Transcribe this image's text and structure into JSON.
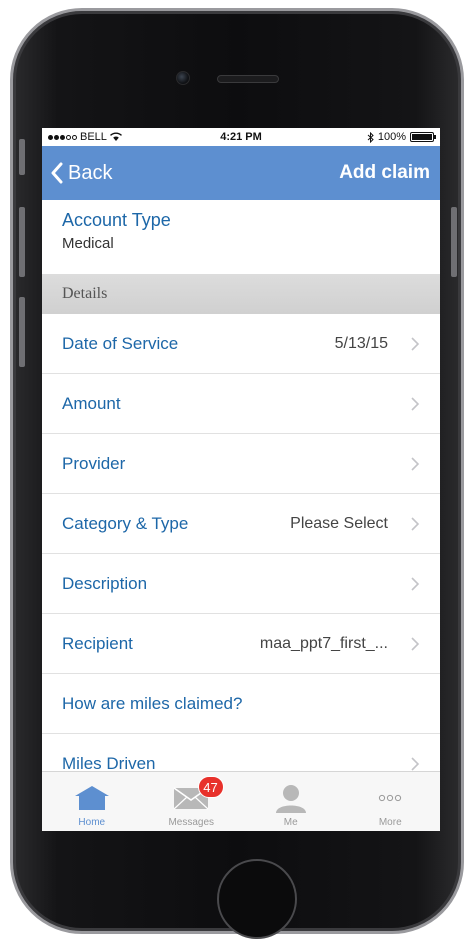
{
  "status_bar": {
    "carrier": "BELL",
    "time": "4:21 PM",
    "battery": "100%"
  },
  "nav": {
    "back_label": "Back",
    "title": "Add claim"
  },
  "account": {
    "label": "Account Type",
    "value": "Medical"
  },
  "section": {
    "title": "Details"
  },
  "rows": [
    {
      "label": "Date of Service",
      "value": "5/13/15"
    },
    {
      "label": "Amount",
      "value": ""
    },
    {
      "label": "Provider",
      "value": ""
    },
    {
      "label": "Category & Type",
      "value": "Please Select"
    },
    {
      "label": "Description",
      "value": ""
    },
    {
      "label": "Recipient",
      "value": "maa_ppt7_first_..."
    },
    {
      "label": "How are miles claimed?",
      "value": ""
    },
    {
      "label": "Miles Driven",
      "value": ""
    }
  ],
  "tabs": [
    {
      "label": "Home",
      "icon": "home-icon"
    },
    {
      "label": "Messages",
      "icon": "envelope-icon",
      "badge": "47"
    },
    {
      "label": "Me",
      "icon": "person-icon"
    },
    {
      "label": "More",
      "icon": "more-icon"
    }
  ],
  "colors": {
    "nav_bar": "#5d8fd0",
    "link_text": "#1d67a8",
    "badge": "#e8312b",
    "active_tab": "#5d8fd0"
  }
}
